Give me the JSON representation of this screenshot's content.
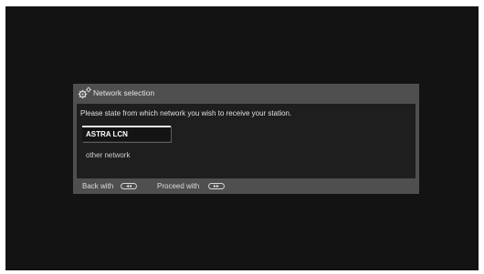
{
  "dialog": {
    "title": "Network selection",
    "title_icon": "gear-icon",
    "prompt": "Please state from which network you wish to receive your station.",
    "options": [
      {
        "label": "ASTRA LCN",
        "selected": true
      },
      {
        "label": "other network",
        "selected": false
      }
    ],
    "footer": {
      "back_label": "Back with",
      "back_icon": "rewind-icon",
      "proceed_label": "Proceed with",
      "proceed_icon": "fast-forward-icon"
    }
  },
  "colors": {
    "screen_bg": "#131313",
    "dialog_frame": "#4f4f4f",
    "dialog_body": "#1e1e1e",
    "highlight": "#e8e8e8"
  }
}
